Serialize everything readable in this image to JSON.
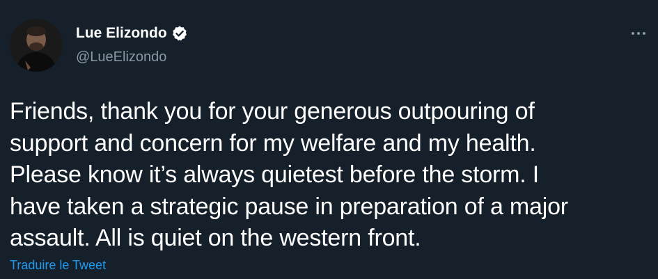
{
  "author": {
    "display_name": "Lue Elizondo",
    "handle": "@LueElizondo",
    "verified": true
  },
  "icons": {
    "verified": "verified-badge-icon",
    "more": "more-horizontal-icon"
  },
  "tweet": {
    "lines": [
      "Friends, thank you for your generous outpouring of",
      "support and concern for my welfare and my health.",
      "Please know it’s always quietest before the storm. I",
      "have taken a strategic pause in preparation of a major",
      "assault. All is quiet on the western front."
    ],
    "translate_label": "Traduire le Tweet"
  },
  "colors": {
    "background": "#15202b",
    "text": "#ffffff",
    "secondary_text": "#8b98a5",
    "link": "#1d9bf0"
  }
}
